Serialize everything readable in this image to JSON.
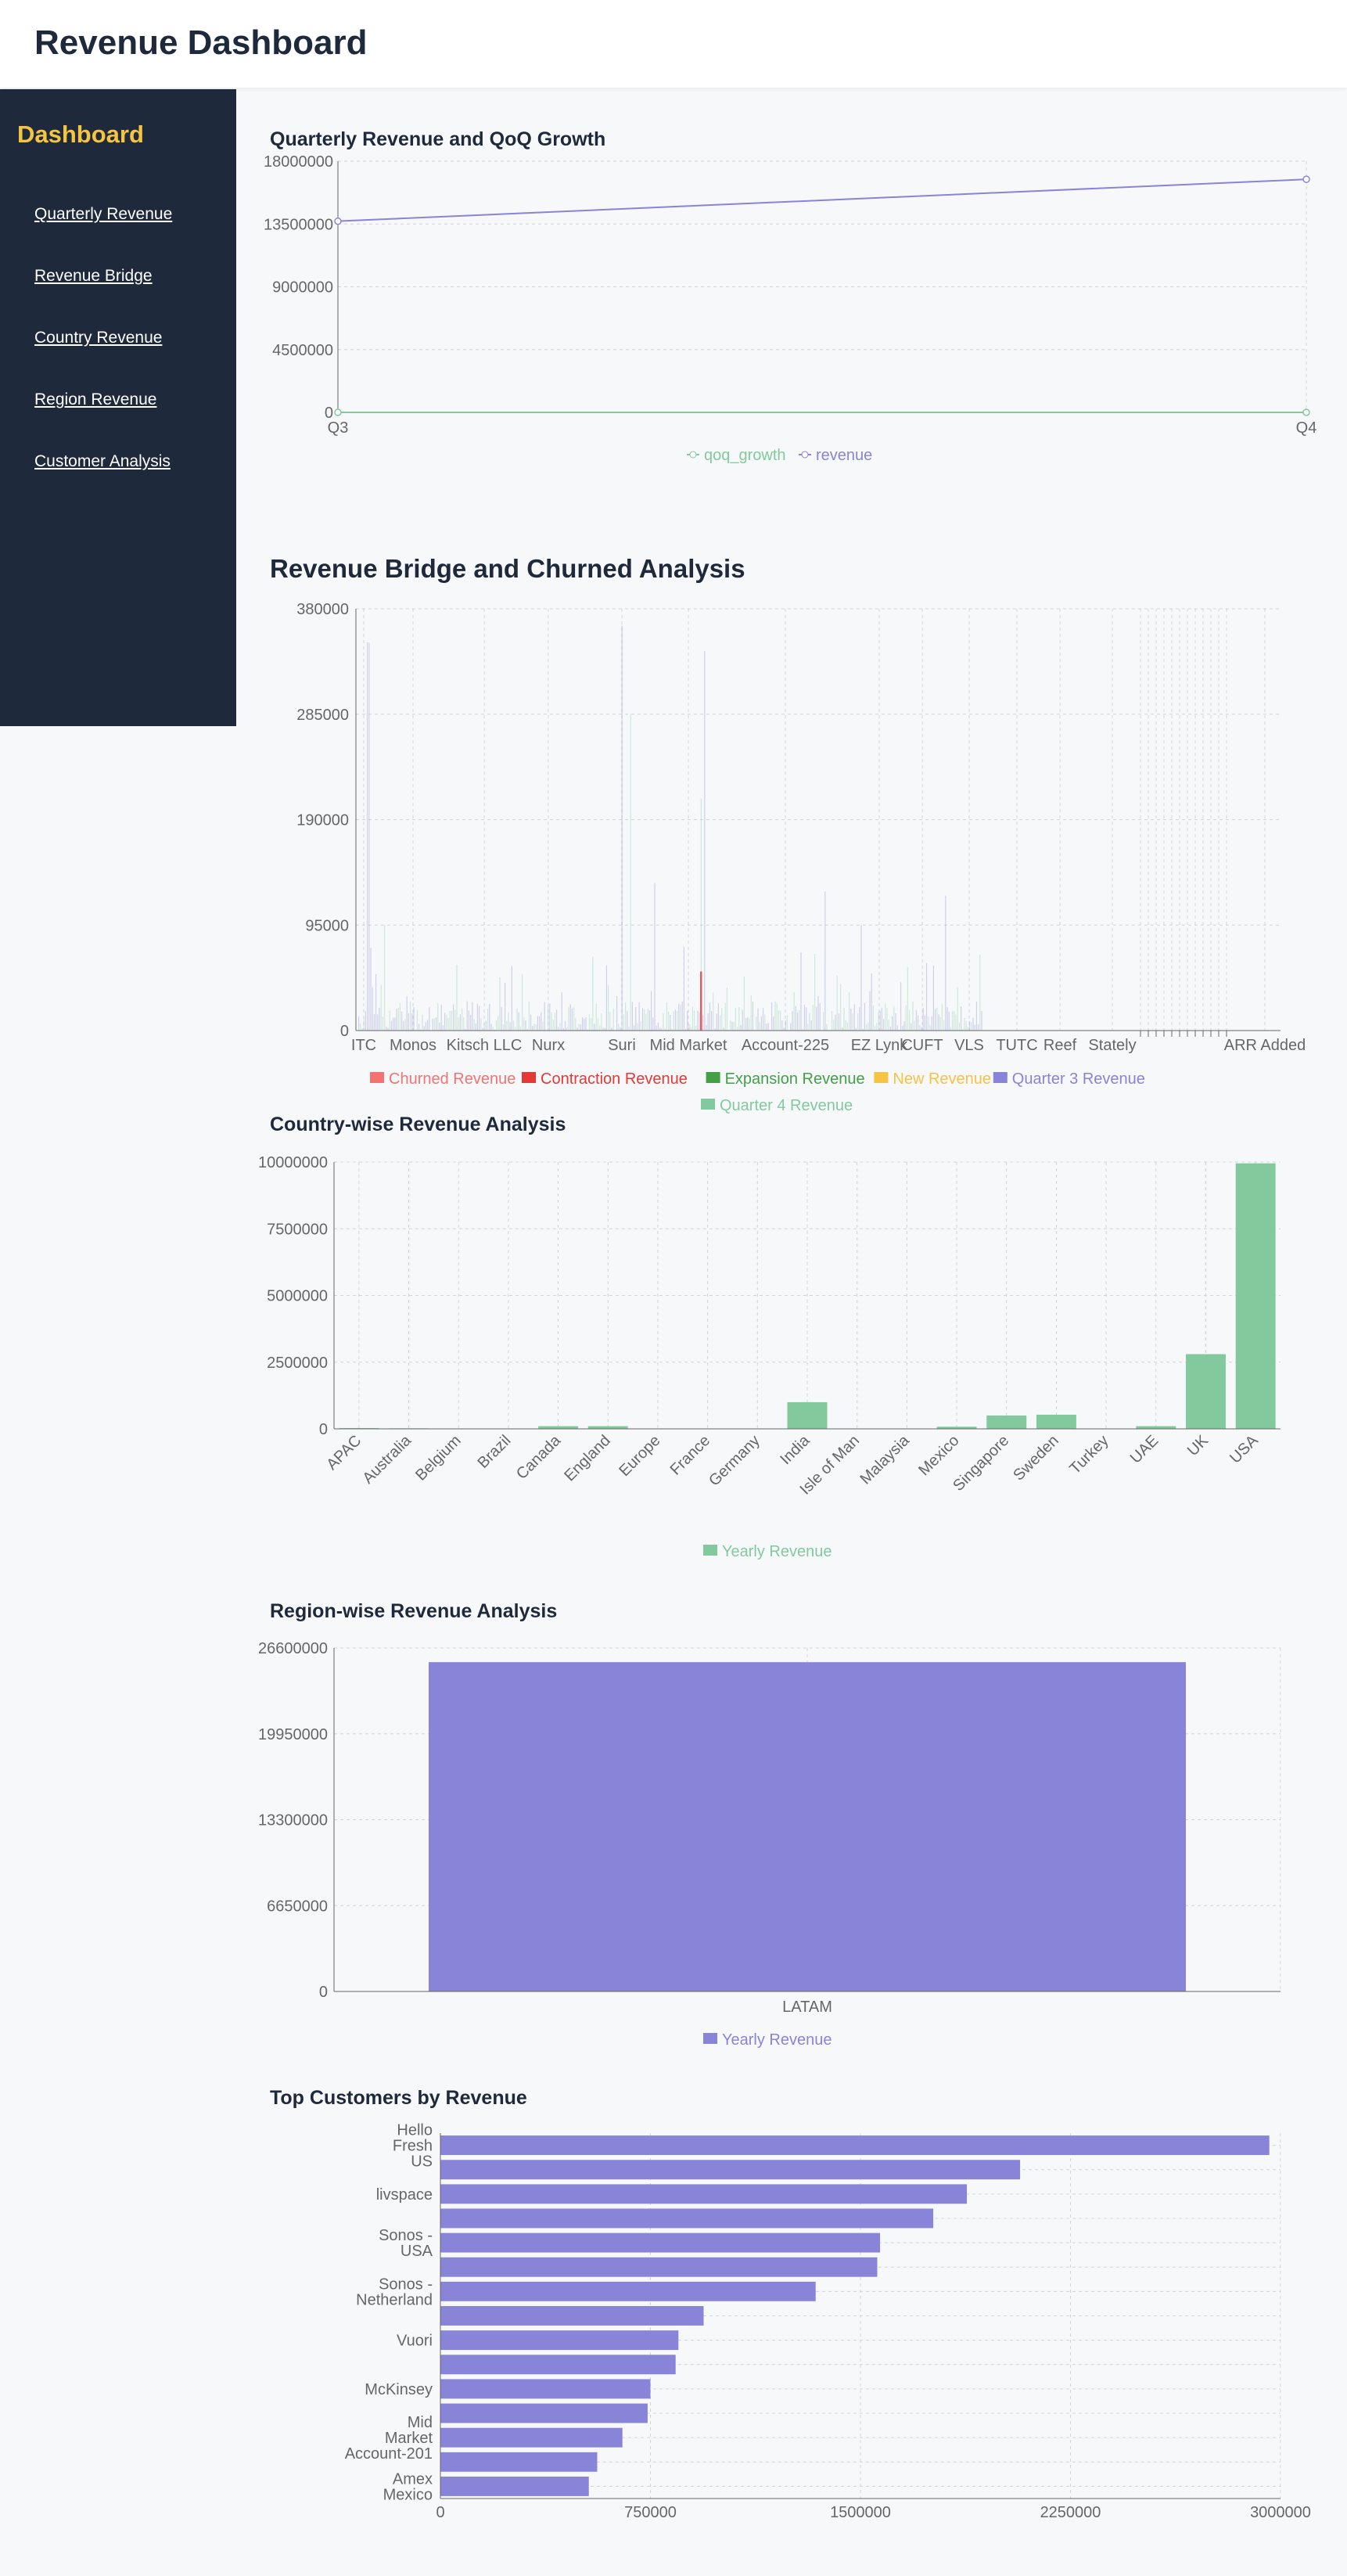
{
  "header": {
    "title": "Revenue Dashboard"
  },
  "sidebar": {
    "brand": "Dashboard",
    "items": [
      {
        "label": "Quarterly Revenue"
      },
      {
        "label": "Revenue Bridge"
      },
      {
        "label": "Country Revenue"
      },
      {
        "label": "Region Revenue"
      },
      {
        "label": "Customer Analysis"
      }
    ]
  },
  "colors": {
    "sidebar_bg": "#1e293b",
    "brand": "#f5c542",
    "green": "#82ca9d",
    "purple": "#8884d8",
    "churned": "#f47272",
    "contraction": "#e53935",
    "expansion": "#43a047",
    "new": "#f6c343"
  },
  "chart_data": [
    {
      "id": "quarterly",
      "type": "line",
      "title": "Quarterly Revenue and QoQ Growth",
      "x": [
        "Q3",
        "Q4"
      ],
      "yticks": [
        "0",
        "4500000",
        "9000000",
        "13500000",
        "18000000"
      ],
      "ylim": [
        0,
        18000000
      ],
      "series": [
        {
          "name": "qoq_growth",
          "color": "#82ca9d",
          "values": [
            0,
            0
          ]
        },
        {
          "name": "revenue",
          "color": "#8884d8",
          "values": [
            13700000,
            16700000
          ]
        }
      ],
      "legend": "bottom-center",
      "grid": true
    },
    {
      "id": "bridge",
      "type": "bar",
      "title": "Revenue Bridge and Churned Analysis",
      "categories": [
        "ITC",
        "Monos",
        "Kitsch LLC",
        "Nurx",
        "Suri",
        "Mid Market",
        "Account-225",
        "EZ Lynk",
        "CUFT",
        "VLS",
        "TUTC",
        "Reef",
        "Stately",
        "ARR Added"
      ],
      "yticks": [
        "0",
        "95000",
        "190000",
        "285000",
        "380000"
      ],
      "ylim": [
        0,
        380000
      ],
      "series": [
        {
          "name": "Churned Revenue",
          "color": "#f47272"
        },
        {
          "name": "Contraction Revenue",
          "color": "#e53935"
        },
        {
          "name": "Expansion Revenue",
          "color": "#43a047"
        },
        {
          "name": "New Revenue",
          "color": "#f6c343"
        },
        {
          "name": "Quarter 3 Revenue",
          "color": "#8884d8"
        },
        {
          "name": "Quarter 4 Revenue",
          "color": "#82ca9d"
        }
      ],
      "legend": "bottom-center",
      "grid": true
    },
    {
      "id": "country",
      "type": "bar",
      "title": "Country-wise Revenue Analysis",
      "categories": [
        "APAC",
        "Australia",
        "Belgium",
        "Brazil",
        "Canada",
        "England",
        "Europe",
        "France",
        "Germany",
        "India",
        "Isle of Man",
        "Malaysia",
        "Mexico",
        "Singapore",
        "Sweden",
        "Turkey",
        "UAE",
        "UK",
        "USA"
      ],
      "series": [
        {
          "name": "Yearly Revenue",
          "color": "#82ca9d",
          "values": [
            30000,
            20000,
            10000,
            10000,
            100000,
            100000,
            10000,
            10000,
            10000,
            1000000,
            5000,
            10000,
            80000,
            500000,
            530000,
            10000,
            100000,
            2800000,
            9950000
          ]
        }
      ],
      "yticks": [
        "0",
        "2500000",
        "5000000",
        "7500000",
        "10000000"
      ],
      "ylim": [
        0,
        10000000
      ],
      "legend": "bottom-center",
      "grid": true
    },
    {
      "id": "region",
      "type": "bar",
      "title": "Region-wise Revenue Analysis",
      "categories": [
        "LATAM"
      ],
      "series": [
        {
          "name": "Yearly Revenue",
          "color": "#8884d8",
          "values": [
            25500000
          ]
        }
      ],
      "yticks": [
        "0",
        "6650000",
        "13300000",
        "19950000",
        "26600000"
      ],
      "ylim": [
        0,
        26600000
      ],
      "legend": "bottom-center",
      "grid": true
    },
    {
      "id": "customers",
      "type": "bar",
      "orientation": "horizontal",
      "title": "Top Customers by Revenue",
      "categories": [
        "Hello Fresh US",
        "",
        "livspace",
        "",
        "Sonos - USA",
        "",
        "Sonos - Netherland",
        "",
        "Vuori",
        "",
        "McKinsey",
        "",
        "Mid Market Account-201",
        "",
        "Amex Mexico"
      ],
      "values": [
        2960000,
        2070000,
        1880000,
        1760000,
        1570000,
        1560000,
        1340000,
        940000,
        850000,
        840000,
        750000,
        740000,
        650000,
        560000,
        530000
      ],
      "series_color": "#8884d8",
      "xticks": [
        "0",
        "750000",
        "1500000",
        "2250000",
        "3000000"
      ],
      "xlim": [
        0,
        3000000
      ],
      "grid": true
    }
  ]
}
